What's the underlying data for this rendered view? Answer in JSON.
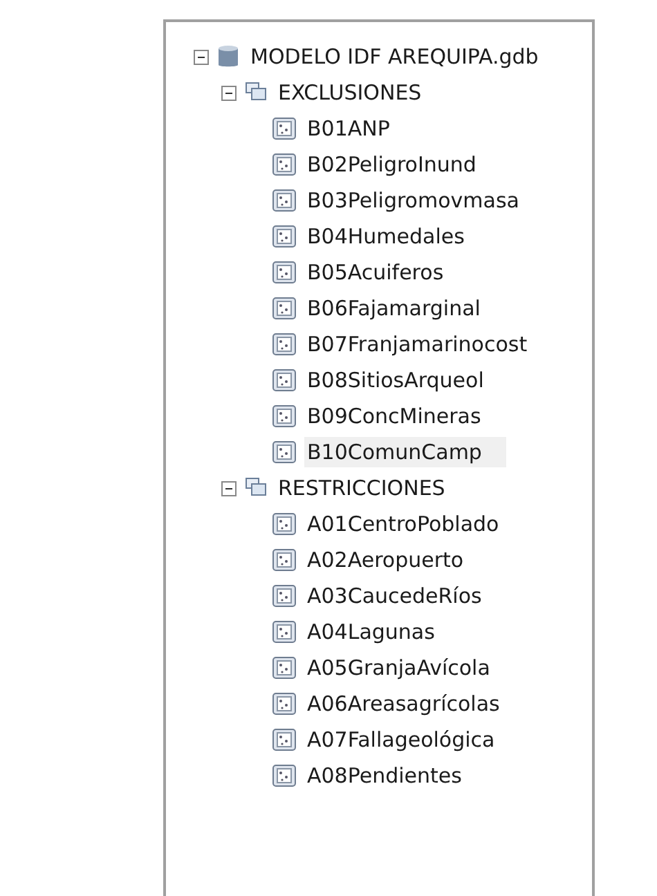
{
  "tree": {
    "label": "MODELO IDF AREQUIPA.gdb",
    "kind": "database",
    "expanded": true,
    "children": [
      {
        "label": "EXCLUSIONES",
        "kind": "dataset",
        "expanded": true,
        "children": [
          {
            "label": "B01ANP",
            "kind": "raster",
            "selected": false
          },
          {
            "label": "B02PeligroInund",
            "kind": "raster",
            "selected": false
          },
          {
            "label": "B03Peligromovmasa",
            "kind": "raster",
            "selected": false
          },
          {
            "label": "B04Humedales",
            "kind": "raster",
            "selected": false
          },
          {
            "label": "B05Acuiferos",
            "kind": "raster",
            "selected": false
          },
          {
            "label": "B06Fajamarginal",
            "kind": "raster",
            "selected": false
          },
          {
            "label": "B07Franjamarinocost",
            "kind": "raster",
            "selected": false
          },
          {
            "label": "B08SitiosArqueol",
            "kind": "raster",
            "selected": false
          },
          {
            "label": "B09ConcMineras",
            "kind": "raster",
            "selected": false
          },
          {
            "label": "B10ComunCamp",
            "kind": "raster",
            "selected": true
          }
        ]
      },
      {
        "label": "RESTRICCIONES",
        "kind": "dataset",
        "expanded": true,
        "children": [
          {
            "label": "A01CentroPoblado",
            "kind": "raster",
            "selected": false
          },
          {
            "label": "A02Aeropuerto",
            "kind": "raster",
            "selected": false
          },
          {
            "label": "A03CaucedeRíos",
            "kind": "raster",
            "selected": false
          },
          {
            "label": "A04Lagunas",
            "kind": "raster",
            "selected": false
          },
          {
            "label": "A05GranjaAvícola",
            "kind": "raster",
            "selected": false
          },
          {
            "label": "A06Areasagrícolas",
            "kind": "raster",
            "selected": false
          },
          {
            "label": "A07Fallageológica",
            "kind": "raster",
            "selected": false
          },
          {
            "label": "A08Pendientes",
            "kind": "raster",
            "selected": false
          }
        ]
      }
    ]
  }
}
